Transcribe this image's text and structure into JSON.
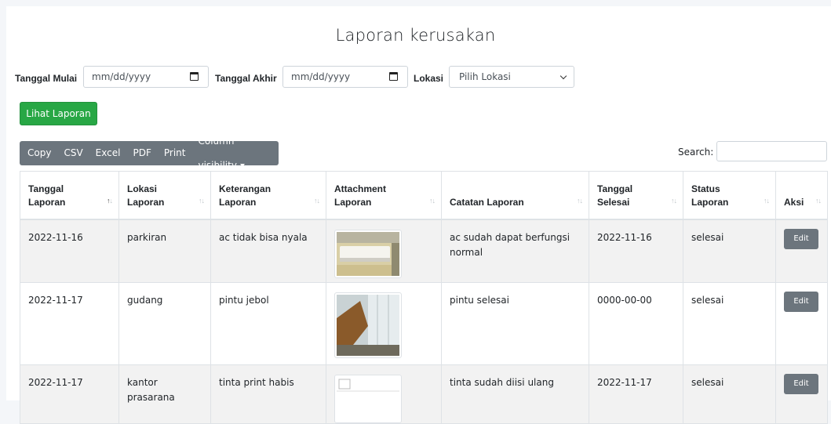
{
  "page": {
    "title": "Laporan kerusakan"
  },
  "filters": {
    "start_label": "Tanggal Mulai",
    "start_placeholder": "mm/dd/yyyy",
    "end_label": "Tanggal Akhir",
    "end_placeholder": "mm/dd/yyyy",
    "location_label": "Lokasi",
    "location_selected": "Pilih Lokasi",
    "view_button": "Lihat Laporan"
  },
  "toolbar": {
    "copy": "Copy",
    "csv": "CSV",
    "excel": "Excel",
    "pdf": "PDF",
    "print": "Print",
    "column_visibility": "Column visibility"
  },
  "search": {
    "label": "Search:"
  },
  "table": {
    "headers": [
      "Tanggal Laporan",
      "Lokasi Laporan",
      "Keterangan Laporan",
      "Attachment Laporan",
      "Catatan Laporan",
      "Tanggal Selesai",
      "Status Laporan",
      "Aksi"
    ],
    "rows": [
      {
        "tanggal": "2022-11-16",
        "lokasi": "parkiran",
        "keterangan": "ac tidak bisa nyala",
        "catatan": "ac sudah dapat berfungsi normal",
        "selesai": "2022-11-16",
        "status": "selesai",
        "aksi": "Edit"
      },
      {
        "tanggal": "2022-11-17",
        "lokasi": "gudang",
        "keterangan": "pintu jebol",
        "catatan": "pintu selesai",
        "selesai": "0000-00-00",
        "status": "selesai",
        "aksi": "Edit"
      },
      {
        "tanggal": "2022-11-17",
        "lokasi": "kantor prasarana",
        "keterangan": "tinta print habis",
        "catatan": "tinta sudah diisi ulang",
        "selesai": "2022-11-17",
        "status": "selesai",
        "aksi": "Edit"
      }
    ]
  },
  "colors": {
    "accent_green": "#28a745",
    "toolbar_gray": "#6c757d"
  }
}
